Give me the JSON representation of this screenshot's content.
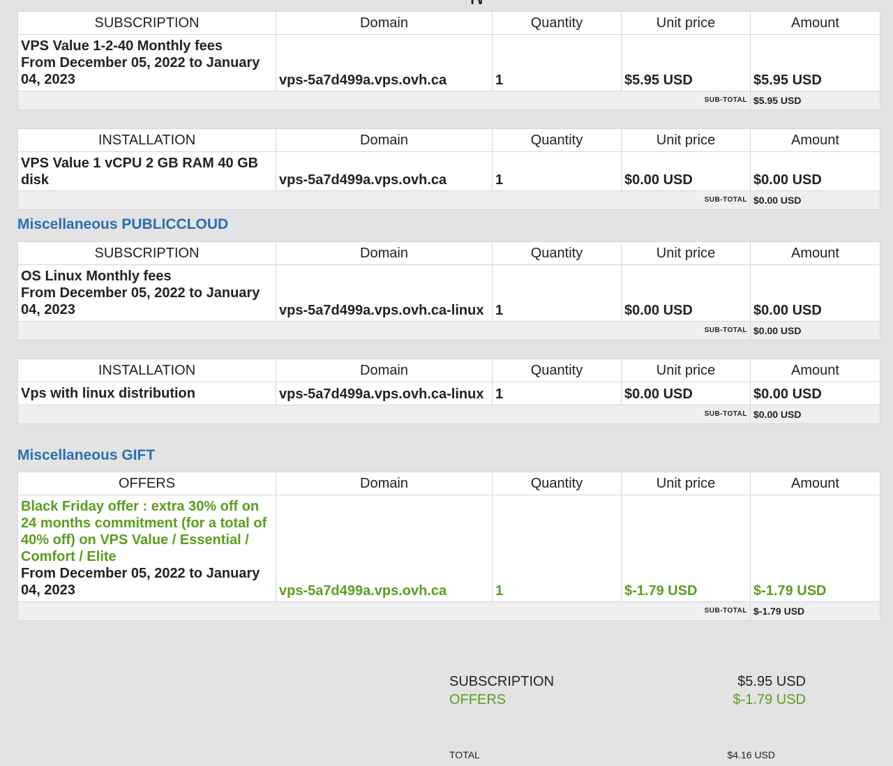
{
  "headers": {
    "domain": "Domain",
    "quantity": "Quantity",
    "unit_price": "Unit price",
    "amount": "Amount"
  },
  "subtotal_label": "SUB-TOTAL",
  "top_fragment": "TW",
  "tables": [
    {
      "type": "SUBSCRIPTION",
      "rows": [
        {
          "desc_line1": "VPS Value 1-2-40 Monthly fees",
          "desc_line2": "From December 05, 2022 to January 04, 2023",
          "domain": "vps-5a7d499a.vps.ovh.ca",
          "quantity": "1",
          "unit_price": "$5.95 USD",
          "amount": "$5.95 USD"
        }
      ],
      "subtotal": "$5.95 USD"
    },
    {
      "type": "INSTALLATION",
      "rows": [
        {
          "desc_line1": "VPS Value 1 vCPU 2 GB RAM 40 GB disk",
          "domain": "vps-5a7d499a.vps.ovh.ca",
          "quantity": "1",
          "unit_price": "$0.00 USD",
          "amount": "$0.00 USD"
        }
      ],
      "subtotal": "$0.00 USD"
    },
    {
      "type": "SUBSCRIPTION",
      "rows": [
        {
          "desc_line1": "OS Linux Monthly fees",
          "desc_line2": "From December 05, 2022 to January 04, 2023",
          "domain": "vps-5a7d499a.vps.ovh.ca-linux",
          "quantity": "1",
          "unit_price": "$0.00 USD",
          "amount": "$0.00 USD"
        }
      ],
      "subtotal": "$0.00 USD"
    },
    {
      "type": "INSTALLATION",
      "rows": [
        {
          "desc_line1": "Vps with linux distribution",
          "domain": "vps-5a7d499a.vps.ovh.ca-linux",
          "quantity": "1",
          "unit_price": "$0.00 USD",
          "amount": "$0.00 USD"
        }
      ],
      "subtotal": "$0.00 USD"
    },
    {
      "type": "OFFERS",
      "rows": [
        {
          "desc_line1": "Black Friday offer : extra 30% off on 24 months commitment (for a total of 40% off) on VPS Value / Essential / Comfort / Elite",
          "desc_line2": "From December 05, 2022 to January 04, 2023",
          "domain": "vps-5a7d499a.vps.ovh.ca",
          "quantity": "1",
          "unit_price": "$-1.79 USD",
          "amount": "$-1.79 USD"
        }
      ],
      "subtotal": "$-1.79 USD"
    }
  ],
  "sections": {
    "publiccloud": "Miscellaneous PUBLICCLOUD",
    "gift": "Miscellaneous GIFT"
  },
  "summary": {
    "subscription_label": "SUBSCRIPTION",
    "subscription_value": "$5.95 USD",
    "offers_label": "OFFERS",
    "offers_value": "$-1.79 USD",
    "total_label": "TOTAL",
    "total_value": "$4.16 USD"
  },
  "colors": {
    "section_title": "#2a6fb0",
    "offer_green": "#5a9e1e",
    "background": "#e3e3e3"
  }
}
